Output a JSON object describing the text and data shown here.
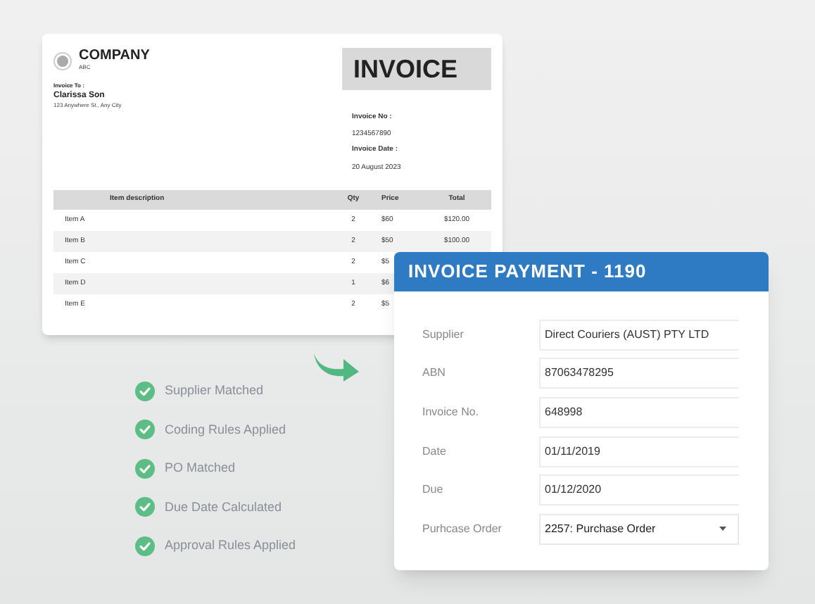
{
  "invoice": {
    "company": "COMPANY",
    "company_sub": "ABC",
    "title": "INVOICE",
    "bill_to_label": "Invoice To :",
    "customer": "Clarissa Son",
    "address": "123 Anywhere St., Any City",
    "invoice_no_label": "Invoice No :",
    "invoice_no": "1234567890",
    "date_label": "Invoice Date :",
    "date": "20 August 2023",
    "table": {
      "columns": [
        "Item description",
        "Qty",
        "Price",
        "Total"
      ],
      "rows": [
        [
          "Item A",
          "2",
          "$60",
          "$120.00"
        ],
        [
          "Item B",
          "2",
          "$50",
          "$100.00"
        ],
        [
          "Item C",
          "2",
          "$5"
        ],
        [
          "Item D",
          "1",
          "$6"
        ],
        [
          "Item E",
          "2",
          "$5"
        ]
      ]
    }
  },
  "checklist": [
    {
      "label": "Supplier Matched",
      "checked": true
    },
    {
      "label": "Coding Rules Applied",
      "checked": true
    },
    {
      "label": "PO Matched",
      "checked": true
    },
    {
      "label": "Due Date Calculated",
      "checked": true
    },
    {
      "label": "Approval Rules Applied",
      "checked": true
    }
  ],
  "payment": {
    "title": "INVOICE PAYMENT - 1190",
    "fields": [
      {
        "label": "Supplier",
        "value": "Direct Couriers (AUST) PTY LTD",
        "kind": "text"
      },
      {
        "label": "ABN",
        "value": "87063478295",
        "kind": "text"
      },
      {
        "label": "Invoice No.",
        "value": "648998",
        "kind": "text"
      },
      {
        "label": "Date",
        "value": "01/11/2019",
        "kind": "text"
      },
      {
        "label": "Due",
        "value": "01/12/2020",
        "kind": "text"
      },
      {
        "label": "Purhcase Order",
        "value": "2257: Purchase Order",
        "kind": "select"
      }
    ]
  }
}
